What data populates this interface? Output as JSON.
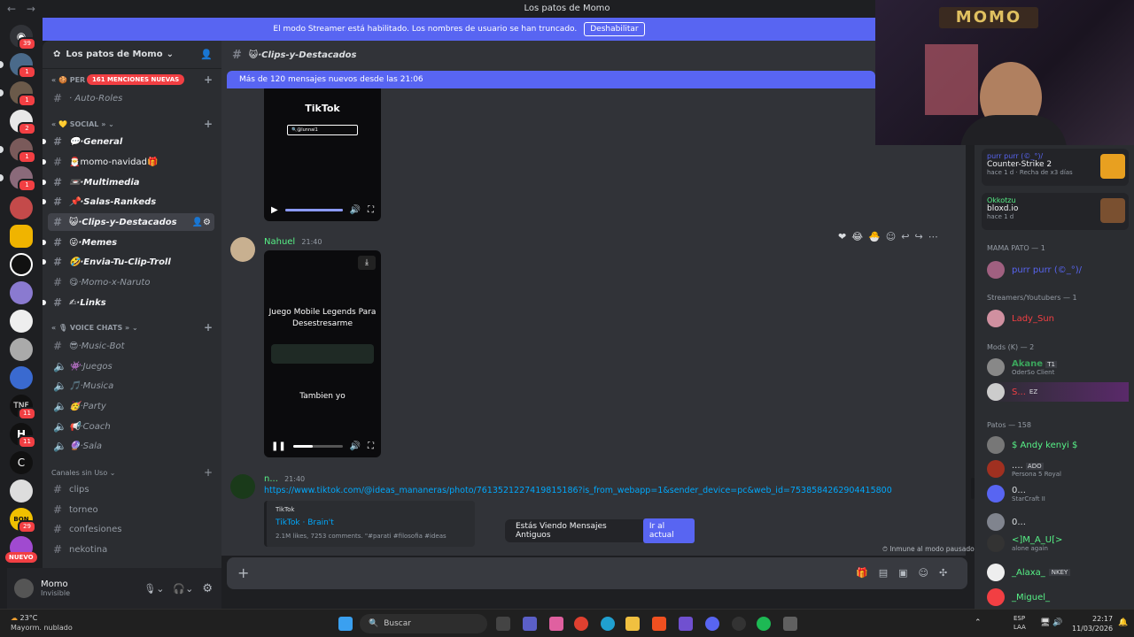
{
  "window": {
    "title": "Los patos de Momo",
    "nav": "← →"
  },
  "banner": {
    "text": "El modo Streamer está habilitado. Los nombres de usuario se han truncado.",
    "button": "Deshabilitar"
  },
  "rail": {
    "nuevo": "NUEVO",
    "badges": [
      "39",
      "1",
      "1",
      "2",
      "1",
      "1",
      "11",
      "11",
      "29"
    ]
  },
  "sidebar": {
    "server_name": "Los patos de Momo",
    "mentions_pill": "161 MENCIONES NUEVAS",
    "per_label": "PER",
    "categories": {
      "social": "SOCIAL",
      "voice": "VOICE CHATS",
      "unused": "Canales sin Uso"
    },
    "channels": [
      {
        "label": "· Auto-Roles"
      },
      {
        "label": "·General"
      },
      {
        "label": "momo-navidad🎁"
      },
      {
        "label": "·Multimedia"
      },
      {
        "label": "·Salas-Rankeds"
      },
      {
        "label": "·Clips-y-Destacados"
      },
      {
        "label": "·Memes"
      },
      {
        "label": "·Envia-Tu-Clip-Troll"
      },
      {
        "label": "·Momo-x-Naruto"
      },
      {
        "label": "·Links"
      },
      {
        "label": "·Music-Bot"
      },
      {
        "label": "·Juegos"
      },
      {
        "label": "·Musica"
      },
      {
        "label": "·Party"
      },
      {
        "label": "·Coach"
      },
      {
        "label": "·Sala"
      },
      {
        "label": "clips"
      },
      {
        "label": "torneo"
      },
      {
        "label": "confesiones"
      },
      {
        "label": "nekotina"
      }
    ]
  },
  "user": {
    "name": "Momo",
    "status": "Invisible"
  },
  "chat": {
    "channel": "·Clips-y-Destacados",
    "new_messages": "Más de 120 mensajes nuevos desde las 21:06",
    "video1": {
      "brand": "TikTok",
      "search": "@lunnai1"
    },
    "msg1": {
      "author": "Nahuel",
      "time": "21:40",
      "caption1": "Juego Mobile Legends Para Desestresarme",
      "caption2": "Tambien yo"
    },
    "msg2": {
      "author": "n...",
      "time": "21:40",
      "link": "https://www.tiktok.com/@ideas_mananeras/photo/7613521227419815186?is_from_webapp=1&sender_device=pc&web_id=7538584262904415800",
      "embed_site": "TikTok",
      "embed_title": "TikTok · Brain't",
      "embed_desc": "2.1M likes, 7253 comments. \"#parati #filosofia #ideas"
    },
    "old_messages": {
      "text": "Estás Viendo Mensajes Antiguos",
      "button": "Ir al actual"
    },
    "immune": "Inmune al modo pausado"
  },
  "members": {
    "activity1": {
      "name": "purr purr (©_°)/",
      "game": "Counter-Strike 2",
      "meta": "hace 1 d",
      "streak": "Recha de x3 días"
    },
    "activity2": {
      "name": "Okkotzu",
      "game": "bloxd.io",
      "meta": "hace 1 d"
    },
    "sections": [
      "MAMA PATO — 1",
      "Streamers/Youtubers — 1",
      "Mods (K) — 2",
      "Patos — 158"
    ],
    "list": [
      {
        "name": "purr purr (©_°)/",
        "color": "#5865f2"
      },
      {
        "name": "Lady_Sun",
        "color": "#f23f43"
      },
      {
        "name": "Akane",
        "color": "#3ba55c",
        "tag": "T1",
        "sub": "OderSo Client"
      },
      {
        "name": "S...",
        "color": "#f23f43",
        "tag": "EZ"
      },
      {
        "name": "$ Andy kenyi $",
        "color": "#57f287"
      },
      {
        "name": "....",
        "color": "#dbdee1",
        "tag": "ADO",
        "sub": "Persona 5 Royal"
      },
      {
        "name": "0...",
        "color": "#dbdee1",
        "sub": "StarCraft II"
      },
      {
        "name": "0...",
        "color": "#dbdee1"
      },
      {
        "name": "<]M_A_U[>",
        "color": "#57f287",
        "sub": "alone again"
      },
      {
        "name": "_Alaxa_",
        "color": "#57f287",
        "tag": "NKEY"
      },
      {
        "name": "_Miguel_",
        "color": "#57f287"
      }
    ]
  },
  "webcam": {
    "sign": "MOMO"
  },
  "taskbar": {
    "weather_temp": "23°C",
    "weather_desc": "Mayorm. nublado",
    "search": "Buscar",
    "lang": "ESP",
    "lang2": "LAA",
    "time": "22:17",
    "date": "11/03/2026"
  }
}
